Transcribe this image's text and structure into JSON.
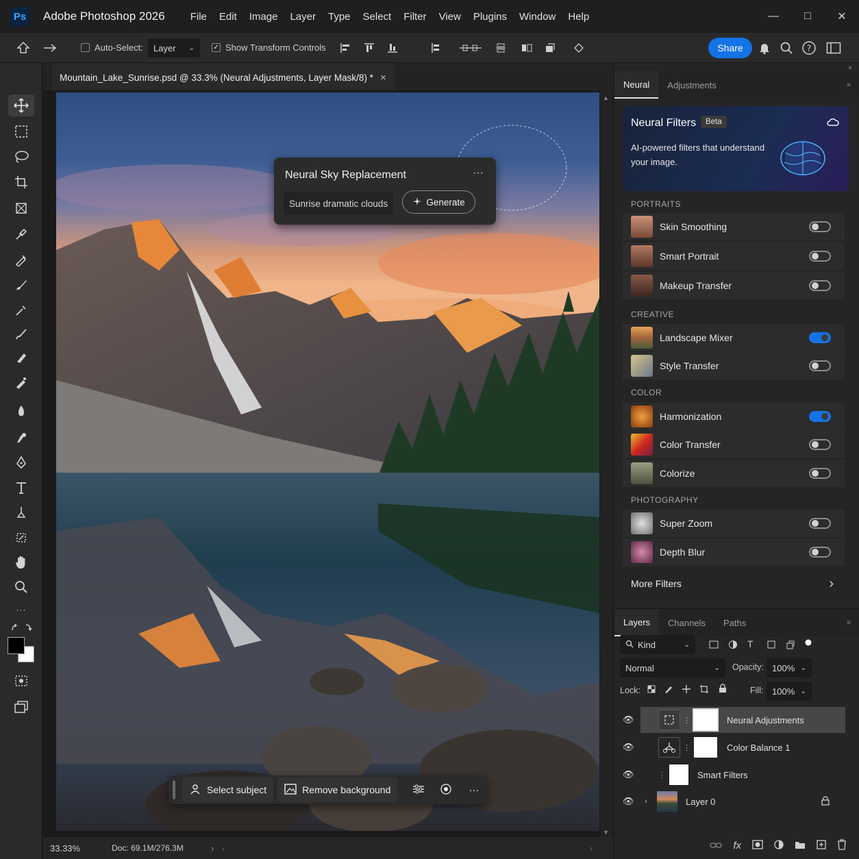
{
  "app": {
    "logo": "Ps",
    "title": "Adobe Photoshop 2026",
    "menu": [
      "File",
      "Edit",
      "Image",
      "Layer",
      "Type",
      "Select",
      "Filter",
      "View",
      "Plugins",
      "Window",
      "Help"
    ]
  },
  "options_bar": {
    "auto_select_label": "Auto-Select:",
    "auto_select_value": "Layer",
    "show_transform_label": "Show Transform Controls",
    "share_label": "Share"
  },
  "document": {
    "tab_title": "Mountain_Lake_Sunrise.psd @ 33.3% (Neural Adjustments, Layer Mask/8) *",
    "close_glyph": "×"
  },
  "status": {
    "zoom": "33.33%",
    "doc_size": "Doc: 69.1M/276.3M"
  },
  "sky_popup": {
    "title": "Neural Sky Replacement",
    "more": "···",
    "prompt": "Sunrise dramatic clouds",
    "generate_label": "Generate"
  },
  "context_bar": {
    "select_subject": "Select subject",
    "remove_background": "Remove background",
    "more": "···"
  },
  "right_panel": {
    "tabs": [
      "Neural",
      "Adjustments"
    ],
    "banner": {
      "title": "Neural Filters",
      "badge": "Beta",
      "description": "AI-powered filters that understand your image."
    },
    "sections": [
      {
        "heading": "PORTRAITS",
        "filters": [
          {
            "label": "Skin Smoothing",
            "on": false
          },
          {
            "label": "Smart Portrait",
            "on": false
          },
          {
            "label": "Makeup Transfer",
            "on": false
          }
        ]
      },
      {
        "heading": "CREATIVE",
        "filters": [
          {
            "label": "Landscape Mixer",
            "on": true
          },
          {
            "label": "Style Transfer",
            "on": false
          }
        ]
      },
      {
        "heading": "COLOR",
        "filters": [
          {
            "label": "Harmonization",
            "on": true
          },
          {
            "label": "Color Transfer",
            "on": false
          },
          {
            "label": "Colorize",
            "on": false
          }
        ]
      },
      {
        "heading": "PHOTOGRAPHY",
        "filters": [
          {
            "label": "Super Zoom",
            "on": false
          },
          {
            "label": "Depth Blur",
            "on": false
          }
        ]
      }
    ],
    "more_filters": "More Filters"
  },
  "layers_panel": {
    "tabs": [
      "Layers",
      "Channels",
      "Paths"
    ],
    "kind_label": "Kind",
    "blend_mode": "Normal",
    "opacity_label": "Opacity:",
    "opacity_value": "100%",
    "lock_label": "Lock:",
    "fill_label": "Fill:",
    "fill_value": "100%",
    "layers": [
      {
        "name": "Neural Adjustments",
        "selected": true
      },
      {
        "name": "Color Balance 1",
        "selected": false
      },
      {
        "name": "Smart Filters",
        "selected": false
      },
      {
        "name": "Layer 0",
        "selected": false
      }
    ]
  },
  "colors": {
    "accent": "#1473e6",
    "panel_bg": "#252525",
    "toolbar_bg": "#2a2a2a"
  }
}
